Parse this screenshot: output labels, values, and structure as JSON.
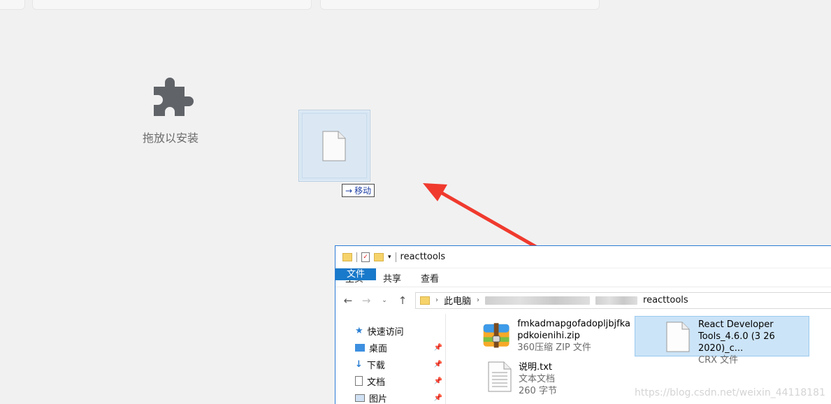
{
  "drop_zone": {
    "label": "拖放以安装"
  },
  "drag": {
    "tooltip": "移动"
  },
  "explorer": {
    "title": "reacttools",
    "ribbon_tabs": [
      "文件",
      "主页",
      "共享",
      "查看"
    ],
    "address": {
      "root": "此电脑",
      "folder": "reacttools"
    },
    "nav_items": [
      {
        "label": "快速访问",
        "icon": "star-icon"
      },
      {
        "label": "桌面",
        "icon": "desktop-icon"
      },
      {
        "label": "下载",
        "icon": "download-icon"
      },
      {
        "label": "文档",
        "icon": "document-icon"
      },
      {
        "label": "图片",
        "icon": "picture-icon"
      }
    ],
    "files": [
      {
        "name_line1": "fmkadmapgofadopljbjfka",
        "name_line2": "pdkoienihi.zip",
        "type": "360压缩 ZIP 文件"
      },
      {
        "name_line1": "React Developer",
        "name_line2": "Tools_4.6.0 (3 26 2020)_c...",
        "type": "CRX 文件"
      },
      {
        "name_line1": "说明.txt",
        "type": "文本文档",
        "size": "260 字节"
      }
    ]
  },
  "watermark": "https://blog.csdn.net/weixin_44118181",
  "colors": {
    "arrow": "#f03a2e",
    "selection": "#cce4f7",
    "file_tab": "#1979ca"
  }
}
